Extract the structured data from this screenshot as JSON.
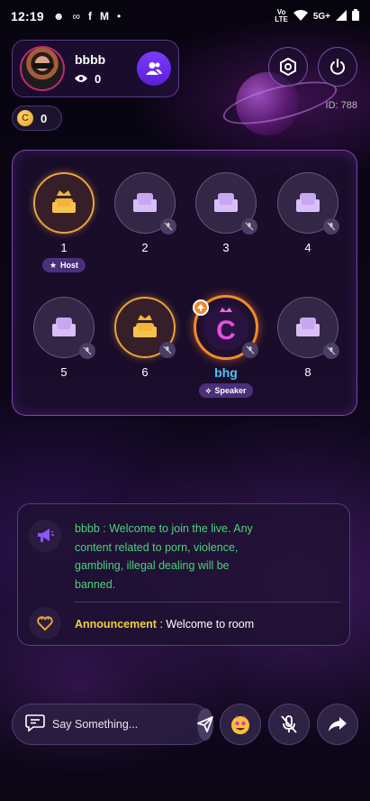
{
  "status_bar": {
    "time": "12:19",
    "network_top": "Vo",
    "network_bottom": "LTE",
    "signal": "5G+"
  },
  "user": {
    "name": "bbbb",
    "viewer_count": "0"
  },
  "coins": {
    "symbol": "C",
    "amount": "0"
  },
  "room": {
    "id_label": "ID: 788"
  },
  "seats": [
    {
      "number": "1",
      "badge": "Host"
    },
    {
      "number": "2"
    },
    {
      "number": "3"
    },
    {
      "number": "4"
    },
    {
      "number": "5"
    },
    {
      "number": "6"
    },
    {
      "number": "bhg",
      "badge": "Speaker",
      "avatar_letter": "C"
    },
    {
      "number": "8"
    }
  ],
  "messages": {
    "system_user": "bbbb",
    "system_text": "bbbb : Welcome to join the live. Any content related to porn, violence, gambling, illegal dealing will be banned.",
    "announcement_label": "Announcement",
    "announcement_text": " : Welcome to room"
  },
  "input": {
    "placeholder": "Say Something..."
  },
  "colors": {
    "accent": "#7b3bff",
    "gold": "#e9a33b",
    "speaker_ring": "#f08a2a",
    "message_green": "#4cd37a",
    "announcement_yellow": "#f3d03a",
    "speaker_name": "#4ec3f0"
  },
  "icons": [
    "profile-avatar",
    "eye-icon",
    "add-friends-icon",
    "settings-hex-icon",
    "power-icon",
    "coin-icon",
    "sofa-icon",
    "crown-icon",
    "mic-off-icon",
    "star-icon",
    "megaphone-icon",
    "chat-icon",
    "send-icon",
    "emoji-icon",
    "share-icon"
  ]
}
